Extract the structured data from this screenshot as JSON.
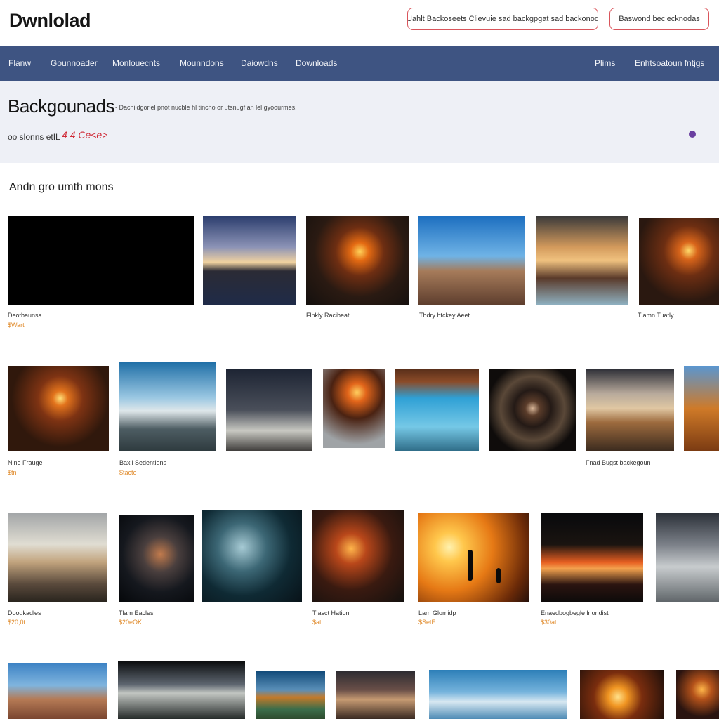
{
  "header": {
    "logo": "Dwnlolad",
    "button_primary": "Uahlt Backoseets Clievuie sad backgpgat sad backonod",
    "button_secondary": "Baswond beclecknodas"
  },
  "nav": {
    "items": [
      "Flanw",
      "Gounnoader",
      "Monlouecnts",
      "Mounndons",
      "Daiowdns",
      "Downloads"
    ],
    "right_items": [
      "Plims",
      "Enhtsoatoun fntjgs"
    ]
  },
  "hero": {
    "title": "Backgounads",
    "description": "- Dachiidgoriel pnot nucble hl tincho or utsnugf an lel gyoourmes.",
    "sublabel": "oo slonns etIL",
    "mark": "4 4 Ce<e>"
  },
  "section_title": "Andn gro umth mons",
  "rows": [
    {
      "items": [
        {
          "caption": "Deotbaunss",
          "price": "$Wart"
        },
        {
          "caption": "",
          "price": ""
        },
        {
          "caption": "Flnkly Racibeat",
          "price": ""
        },
        {
          "caption": "Thdry htckey Aeet",
          "price": ""
        },
        {
          "caption": "",
          "price": ""
        },
        {
          "caption": "Tlamn Tuatly",
          "price": ""
        }
      ]
    },
    {
      "items": [
        {
          "caption": "Nine Frauge",
          "price": "$tn"
        },
        {
          "caption": "Baxll Sedentions",
          "price": "$tacte"
        },
        {
          "caption": "",
          "price": ""
        },
        {
          "caption": "",
          "price": ""
        },
        {
          "caption": "",
          "price": ""
        },
        {
          "caption": "",
          "price": ""
        },
        {
          "caption": "Fnad Bugst backegoun",
          "price": ""
        },
        {
          "caption": "",
          "price": ""
        }
      ]
    },
    {
      "items": [
        {
          "caption": "Doodkadles",
          "price": "$20,0t"
        },
        {
          "caption": "Tlam Eacles",
          "price": "$20eOK"
        },
        {
          "caption": "",
          "price": ""
        },
        {
          "caption": "Tlasct Hation",
          "price": "$at"
        },
        {
          "caption": "Lam Glomidp",
          "price": "$SetE"
        },
        {
          "caption": "Enaedbogbegle lnondist",
          "price": "$30at"
        },
        {
          "caption": "",
          "price": ""
        }
      ]
    }
  ],
  "colors": {
    "nav_bg": "#3e5482",
    "hero_bg": "#eef0f6",
    "accent_red": "#d9545b",
    "price": "#e08a2a"
  }
}
